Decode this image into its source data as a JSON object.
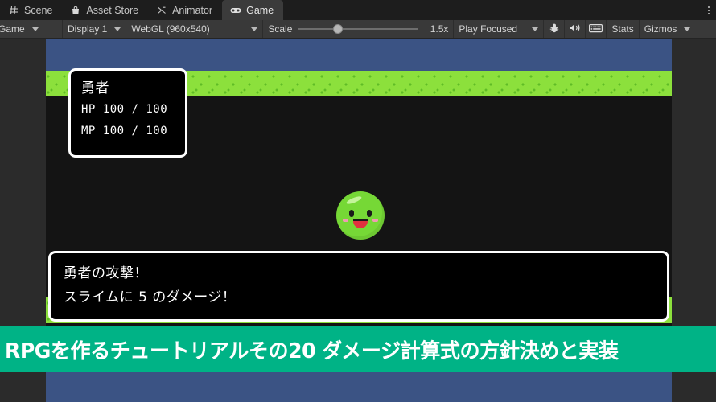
{
  "tabs": [
    {
      "label": "Scene",
      "icon": "grid-icon",
      "active": false
    },
    {
      "label": "Asset Store",
      "icon": "shop-bag-icon",
      "active": false
    },
    {
      "label": "Animator",
      "icon": "animator-icon",
      "active": false
    },
    {
      "label": "Game",
      "icon": "gamepad-icon",
      "active": true
    }
  ],
  "toolbar": {
    "view_mode": "Game",
    "display": "Display 1",
    "resolution": "WebGL (960x540)",
    "scale_label": "Scale",
    "scale_value": "1.5x",
    "play_mode": "Play Focused",
    "mute_icon": "speaker-icon",
    "debug_icon": "bug-icon",
    "keyboard_icon": "keyboard-icon",
    "stats_label": "Stats",
    "gizmos_label": "Gizmos",
    "kebab_icon": "more-options-icon"
  },
  "game": {
    "status_window": {
      "name": "勇者",
      "hp": "HP  100 / 100",
      "mp": "MP  100 / 100"
    },
    "message_window": {
      "line1": "勇者の攻撃！",
      "line2": "スライムに 5 のダメージ！"
    },
    "enemy": "slime-sprite"
  },
  "banner": {
    "text": "RPGを作るチュートリアルその20 ダメージ計算式の方針決めと実装",
    "background_color": "#00b386",
    "text_color": "#ffffff"
  },
  "colors": {
    "sky": "#3b5384",
    "grass": "#8ce03c",
    "grass_detail": "#5fbc26",
    "ground": "#141414",
    "slime": "#76d836",
    "tab_active": "#3b3b3b",
    "toolbar": "#393939",
    "letterbox": "#2b2b2b"
  }
}
